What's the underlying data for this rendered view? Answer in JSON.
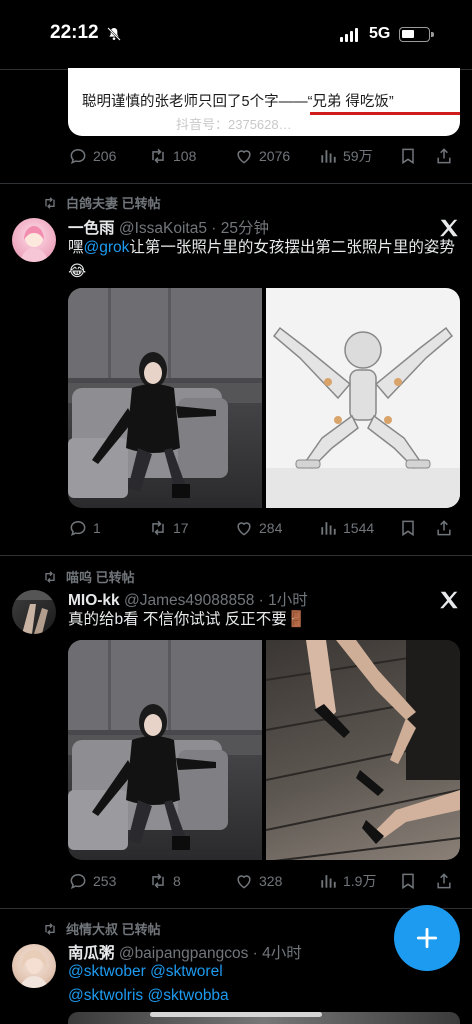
{
  "status_bar": {
    "time": "22:12",
    "network": "5G"
  },
  "quote_card": {
    "text": "聪明谨慎的张老师只回了5个字——“兄弟 得吃饭”",
    "watermark": "抖音号：2375628…"
  },
  "tweets": [
    {
      "actions": {
        "replies": "206",
        "reposts": "108",
        "likes": "2076",
        "views": "59万"
      }
    },
    {
      "repost_by": "白鸽夫妻 已转帖",
      "name": "一色雨",
      "meta": "@IssaKoita5 · 25分钟",
      "text_prefix": "嘿",
      "mention": "@grok",
      "text_suffix": "让第一张照片里的女孩摆出第二张照片里的姿势",
      "emoji": "😂",
      "actions": {
        "replies": "1",
        "reposts": "17",
        "likes": "284",
        "views": "1544"
      }
    },
    {
      "repost_by": "喵呜 已转帖",
      "name": "MIO-kk",
      "meta": "@James49088858 · 1小时",
      "text": "真的给b看 不信你试试 反正不要",
      "emoji": "🚪",
      "actions": {
        "replies": "253",
        "reposts": "8",
        "likes": "328",
        "views": "1.9万"
      }
    },
    {
      "repost_by": "纯情大叔 已转帖",
      "name": "南瓜粥",
      "meta": "@baipangpangcos · 4小时",
      "line1": "@sktwober @sktworel",
      "line2": "@sktwolris @sktwobba"
    }
  ],
  "colors": {
    "accent": "#1d9bf0",
    "muted": "#71767b",
    "text": "#e7e9ea",
    "background": "#000000"
  },
  "icons": [
    "bell-off-icon",
    "signal-icon",
    "battery-icon",
    "reply-icon",
    "repost-icon",
    "like-icon",
    "views-icon",
    "bookmark-icon",
    "share-icon",
    "x-logo-icon",
    "compose-plus-icon"
  ]
}
